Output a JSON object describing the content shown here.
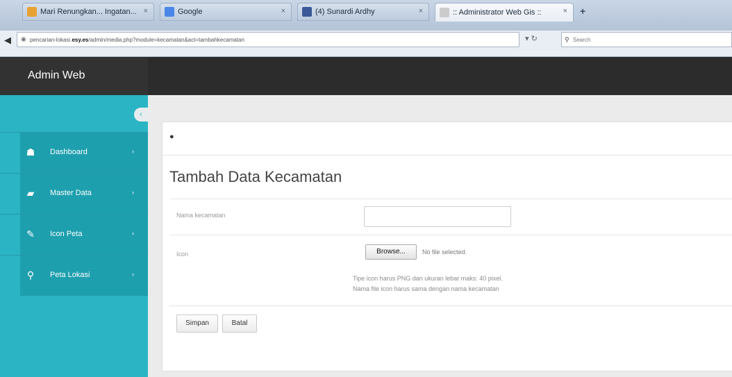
{
  "browser": {
    "tabs": [
      {
        "label": "Mari Renungkan... Ingatan...",
        "fav_color": "#e8a133",
        "active": false
      },
      {
        "label": "Google",
        "fav_color": "#4a86e8",
        "active": false
      },
      {
        "label": "(4) Sunardi Ardhy",
        "fav_color": "#3b5998",
        "active": false
      },
      {
        "label": ":: Administrator Web Gis ::",
        "fav_color": "#cccccc",
        "active": true
      }
    ],
    "new_tab": "+",
    "tab_close": "×",
    "url_prefix": "pencarian-lokasi.",
    "url_host": "esy.es",
    "url_path": "/admin/media.php?module=kecamatan&act=tambahkecamatan",
    "search_placeholder": "Search"
  },
  "header": {
    "brand": "Admin Web"
  },
  "sidebar": {
    "collapse_glyph": "‹",
    "items": [
      {
        "label": "Dashboard",
        "icon": "☗"
      },
      {
        "label": "Master Data",
        "icon": "▰"
      },
      {
        "label": "Icon Peta",
        "icon": "✎"
      },
      {
        "label": "Peta Lokasi",
        "icon": "⚲"
      }
    ],
    "arrow": "›"
  },
  "main": {
    "breadcrumb_glyph": "●",
    "title": "Tambah Data Kecamatan",
    "fields": {
      "nama_label": "Nama kecamatan",
      "nama_value": "",
      "icon_label": "Icon",
      "browse_label": "Browse...",
      "no_file": "No file selected.",
      "help_1": "Tipe icon harus PNG dan ukuran lebar maks: 40 pixel.",
      "help_2": "Nama file icon harus sama dengan nama kecamatan"
    },
    "buttons": {
      "save": "Simpan",
      "cancel": "Batal"
    }
  }
}
